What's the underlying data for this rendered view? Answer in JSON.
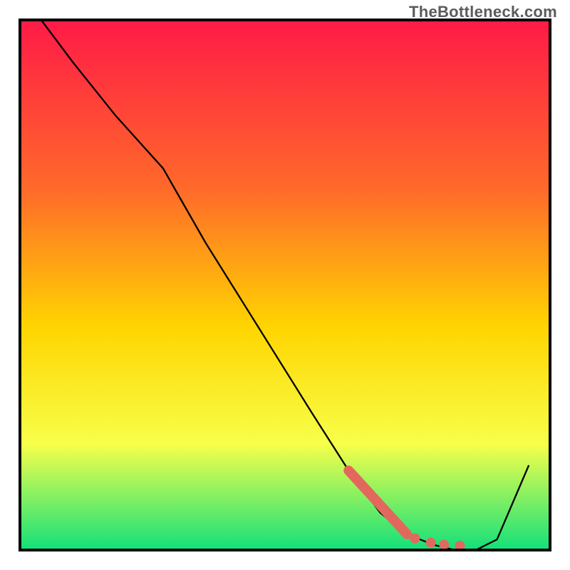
{
  "watermark": "TheBottleneck.com",
  "colors": {
    "gradient_top": "#ff1a47",
    "gradient_mid1": "#ff6a2a",
    "gradient_mid2": "#ffd500",
    "gradient_mid3": "#f7ff4a",
    "gradient_bottom": "#12e07a",
    "border": "#000000",
    "curve": "#000000",
    "marker": "#e2685e"
  },
  "chart_data": {
    "type": "line",
    "title": "",
    "xlabel": "",
    "ylabel": "",
    "xlim": [
      0,
      100
    ],
    "ylim": [
      0,
      100
    ],
    "series": [
      {
        "name": "bottleneck-curve",
        "x": [
          4,
          10,
          18,
          27,
          35,
          45,
          55,
          62,
          68,
          73,
          78,
          82,
          86,
          90,
          96
        ],
        "y": [
          100,
          92,
          82,
          72,
          58,
          42,
          26,
          15,
          7,
          3,
          1,
          0,
          0,
          2,
          16
        ]
      }
    ],
    "markers": [
      {
        "name": "highlight-segment",
        "kind": "thick-line",
        "x": [
          62,
          73
        ],
        "y": [
          15,
          3
        ]
      },
      {
        "name": "dot-1",
        "kind": "dot",
        "x": 74.5,
        "y": 2.2
      },
      {
        "name": "dot-2",
        "kind": "dot",
        "x": 77.5,
        "y": 1.4
      },
      {
        "name": "dot-3",
        "kind": "dot",
        "x": 80,
        "y": 1.0
      },
      {
        "name": "dot-4",
        "kind": "dot",
        "x": 83,
        "y": 0.8
      }
    ],
    "annotations": []
  }
}
